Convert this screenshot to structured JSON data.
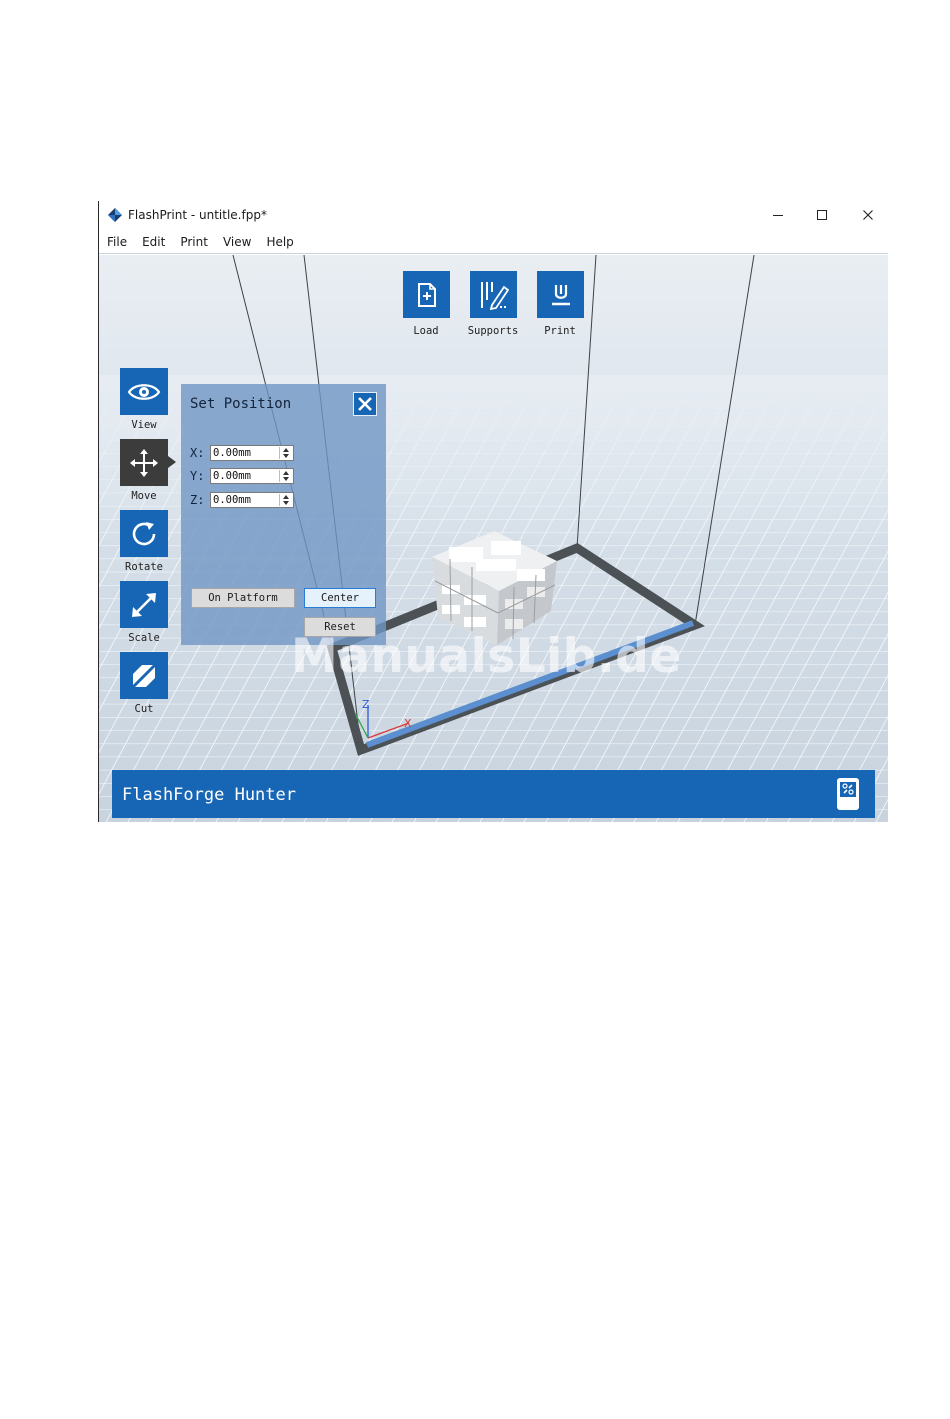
{
  "window": {
    "title": "FlashPrint - untitle.fpp*",
    "controls": [
      "minimize",
      "maximize",
      "close"
    ]
  },
  "menu": [
    "File",
    "Edit",
    "Print",
    "View",
    "Help"
  ],
  "toolbar": [
    {
      "label": "Load",
      "icon": "load-file-icon"
    },
    {
      "label": "Supports",
      "icon": "supports-icon"
    },
    {
      "label": "Print",
      "icon": "print-icon"
    }
  ],
  "sidebar": [
    {
      "label": "View",
      "icon": "eye-icon",
      "active": false
    },
    {
      "label": "Move",
      "icon": "move-arrows-icon",
      "active": true
    },
    {
      "label": "Rotate",
      "icon": "rotate-icon",
      "active": false
    },
    {
      "label": "Scale",
      "icon": "scale-icon",
      "active": false
    },
    {
      "label": "Cut",
      "icon": "cut-icon",
      "active": false
    }
  ],
  "set_position": {
    "title": "Set Position",
    "fields": [
      {
        "label": "X:",
        "value": "0.00mm"
      },
      {
        "label": "Y:",
        "value": "0.00mm"
      },
      {
        "label": "Z:",
        "value": "0.00mm"
      }
    ],
    "buttons": {
      "on_platform": "On Platform",
      "center": "Center",
      "reset": "Reset"
    }
  },
  "watermark": "ManualsLib.de",
  "axes": {
    "z": "Z",
    "x": "X"
  },
  "status": {
    "printer": "FlashForge Hunter"
  },
  "colors": {
    "accent": "#1766b5",
    "active_tool": "#3c3c3c",
    "panel": "#7196c4",
    "platform_frame": "#4c5156",
    "platform_front_edge": "#5b8fcf"
  }
}
